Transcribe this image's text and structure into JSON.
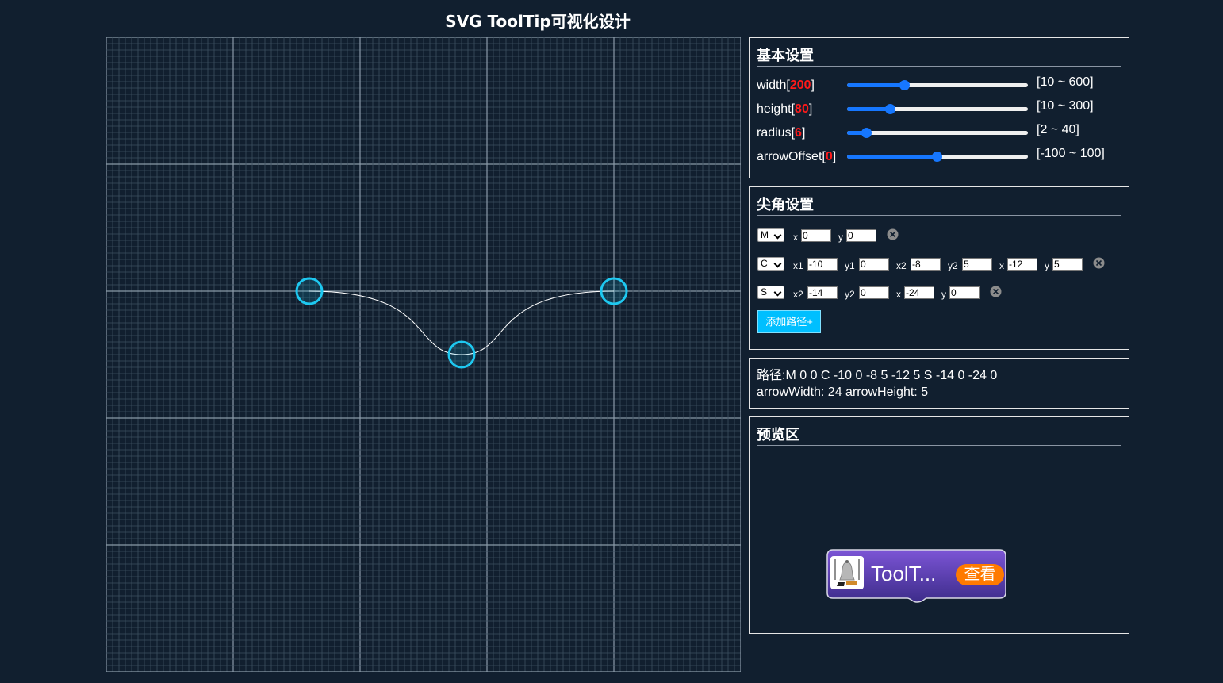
{
  "title": "SVG ToolTip可视化设计",
  "basic": {
    "heading": "基本设置",
    "settings": [
      {
        "name": "width",
        "value": "200",
        "range": "[10 ~ 600]",
        "fraction": 0.32
      },
      {
        "name": "height",
        "value": "80",
        "range": "[10 ~ 300]",
        "fraction": 0.24
      },
      {
        "name": "radius",
        "value": "6",
        "range": "[2 ~ 40]",
        "fraction": 0.11
      },
      {
        "name": "arrowOffset",
        "value": "0",
        "range": "[-100 ~ 100]",
        "fraction": 0.5
      }
    ]
  },
  "arrow": {
    "heading": "尖角设置",
    "commands": [
      {
        "cmd": "M",
        "fields": [
          {
            "label": "x",
            "value": "0"
          },
          {
            "label": "y",
            "value": "0"
          }
        ]
      },
      {
        "cmd": "C",
        "fields": [
          {
            "label": "x1",
            "value": "-10"
          },
          {
            "label": "y1",
            "value": "0"
          },
          {
            "label": "x2",
            "value": "-8"
          },
          {
            "label": "y2",
            "value": "5"
          },
          {
            "label": "x",
            "value": "-12"
          },
          {
            "label": "y",
            "value": "5"
          }
        ]
      },
      {
        "cmd": "S",
        "fields": [
          {
            "label": "x2",
            "value": "-14"
          },
          {
            "label": "y2",
            "value": "0"
          },
          {
            "label": "x",
            "value": "-24"
          },
          {
            "label": "y",
            "value": "0"
          }
        ]
      }
    ],
    "add_button": "添加路径+"
  },
  "path_info": {
    "path_line": "路径:M 0 0 C -10 0 -8 5 -12 5 S -14 0 -24 0",
    "size_line": "arrowWidth: 24 arrowHeight: 5"
  },
  "preview": {
    "heading": "预览区",
    "tooltip_text": "ToolT...",
    "tooltip_button": "查看",
    "icon": "bell-icon"
  },
  "colors": {
    "background": "#111f2f",
    "grid_minor": "#3c5061",
    "grid_major": "#8a9aa8",
    "handle": "#1ec8f0",
    "accent_value": "#ff1a1a",
    "slider": "#1677ff",
    "add_button": "#00bfff",
    "tooltip_button": "#ff7a00"
  },
  "canvas": {
    "handles": [
      {
        "name": "start",
        "x": 0,
        "y": 0
      },
      {
        "name": "mid",
        "x": -12,
        "y": 5
      },
      {
        "name": "end",
        "x": -24,
        "y": 0
      }
    ]
  }
}
